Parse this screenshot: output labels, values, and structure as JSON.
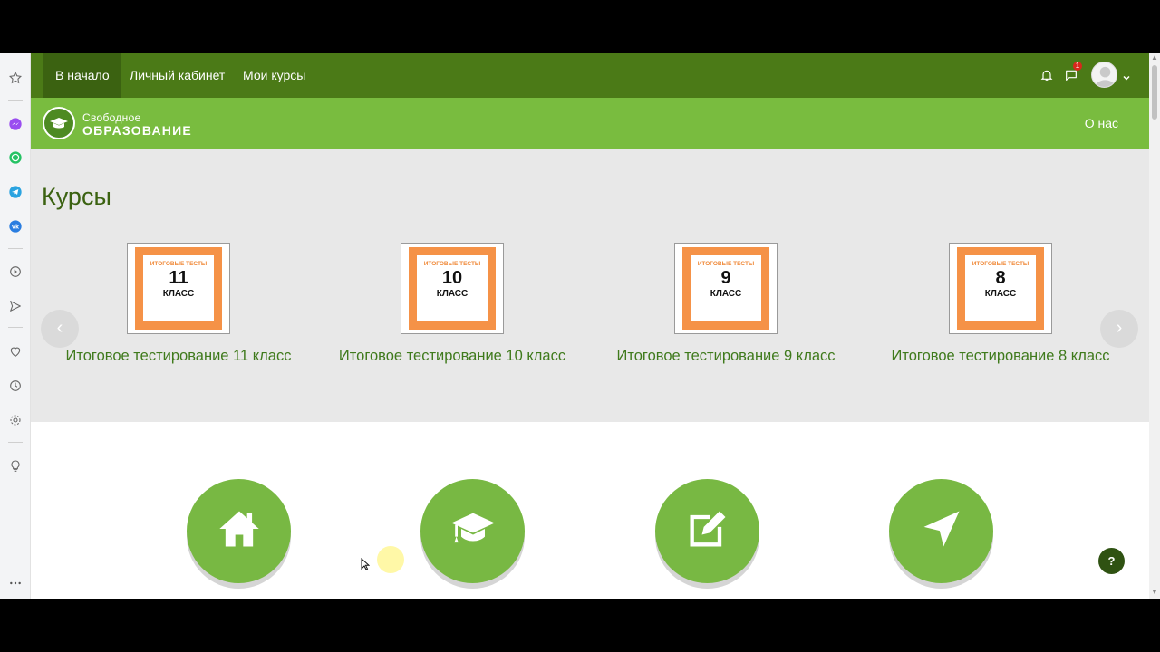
{
  "browser_sidebar": {
    "icons": [
      "star-icon",
      "messenger-icon",
      "whatsapp-icon",
      "telegram-icon",
      "vk-icon",
      "play-icon",
      "send-icon",
      "heart-icon",
      "clock-icon",
      "settings-icon",
      "lightbulb-icon",
      "more-icon"
    ]
  },
  "topnav": {
    "items": [
      "В начало",
      "Личный кабинет",
      "Мои курсы"
    ],
    "active": "В начало",
    "notifications_badge": "1",
    "bg_color": "#4b7a17"
  },
  "header": {
    "logo_line1": "Свободное",
    "logo_line2": "ОБРАЗОВАНИЕ",
    "about_link": "О нас",
    "bg_color": "#79bc3f"
  },
  "courses": {
    "title": "Курсы",
    "items": [
      {
        "thumb_top": "ИТОГОВЫЕ ТЕСТЫ",
        "thumb_num": "11",
        "thumb_class": "КЛАСС",
        "label": "Итоговое тестирование 11 класс"
      },
      {
        "thumb_top": "ИТОГОВЫЕ ТЕСТЫ",
        "thumb_num": "10",
        "thumb_class": "КЛАСС",
        "label": "Итоговое тестирование 10 класс"
      },
      {
        "thumb_top": "ИТОГОВЫЕ ТЕСТЫ",
        "thumb_num": "9",
        "thumb_class": "КЛАСС",
        "label": "Итоговое тестирование 9 класс"
      },
      {
        "thumb_top": "ИТОГОВЫЕ ТЕСТЫ",
        "thumb_num": "8",
        "thumb_class": "КЛАСС",
        "label": "Итоговое тестирование 8 класс"
      }
    ],
    "prev_arrow": "‹",
    "next_arrow": "›"
  },
  "features": {
    "icons": [
      "home-icon",
      "graduation-cap-icon",
      "edit-icon",
      "navigation-arrow-icon"
    ],
    "accent": "#78b843"
  },
  "help": {
    "label": "?"
  }
}
